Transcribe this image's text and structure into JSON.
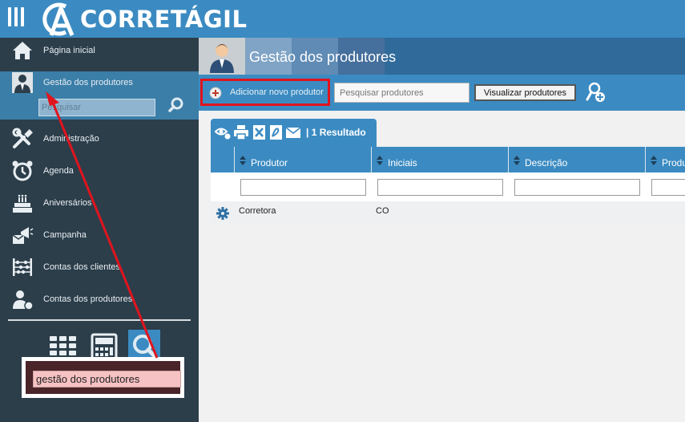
{
  "app": {
    "name": "CORRETÁGIL"
  },
  "sidebar": {
    "items": [
      {
        "label": "Página inicial",
        "icon": "home-icon"
      },
      {
        "label": "Gestão dos produtores",
        "icon": "producer-icon"
      },
      {
        "label": "Administração",
        "icon": "tools-icon"
      },
      {
        "label": "Agenda",
        "icon": "alarm-clock-icon"
      },
      {
        "label": "Aniversários",
        "icon": "cake-icon"
      },
      {
        "label": "Campanha",
        "icon": "megaphone-icon"
      },
      {
        "label": "Contas dos clientes",
        "icon": "abacus-icon"
      },
      {
        "label": "Contas dos produtores",
        "icon": "user-money-icon"
      }
    ],
    "search_placeholder": "Pesquisar",
    "popup_search_value": "gestão dos produtores"
  },
  "header": {
    "title": "Gestão dos produtores"
  },
  "toolbar": {
    "add_label": "Adicionar novo produtor",
    "search_placeholder": "Pesquisar produtores",
    "view_label": "Visualizar produtores"
  },
  "grid": {
    "result_label": "| 1 Resultado",
    "columns": [
      "Produtor",
      "Iniciais",
      "Descrição",
      "Produ"
    ],
    "rows": [
      {
        "produtor": "Corretora",
        "iniciais": "CO",
        "descricao": ""
      }
    ]
  },
  "colors": {
    "accent": "#3b8bc2",
    "sidebar": "#2c3e4a",
    "highlight": "#e0141e"
  }
}
